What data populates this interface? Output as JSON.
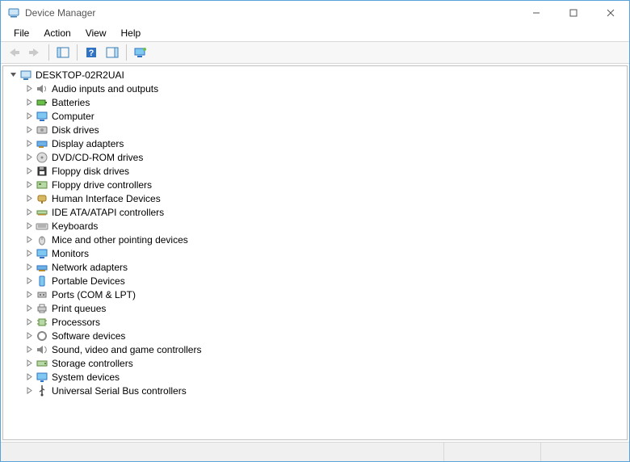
{
  "titlebar": {
    "title": "Device Manager"
  },
  "menubar": {
    "items": [
      "File",
      "Action",
      "View",
      "Help"
    ]
  },
  "toolbar": {
    "back": "Back",
    "forward": "Forward",
    "showhide": "Show/Hide Console Tree",
    "help": "Help",
    "actionpane": "Show/Hide Action Pane",
    "monitor": "Scan for hardware changes"
  },
  "tree": {
    "root": "DESKTOP-02R2UAI",
    "categories": [
      {
        "label": "Audio inputs and outputs",
        "icon": "speaker-icon"
      },
      {
        "label": "Batteries",
        "icon": "battery-icon"
      },
      {
        "label": "Computer",
        "icon": "monitor-icon"
      },
      {
        "label": "Disk drives",
        "icon": "disk-icon"
      },
      {
        "label": "Display adapters",
        "icon": "display-adapter-icon"
      },
      {
        "label": "DVD/CD-ROM drives",
        "icon": "optical-icon"
      },
      {
        "label": "Floppy disk drives",
        "icon": "floppy-icon"
      },
      {
        "label": "Floppy drive controllers",
        "icon": "floppy-controller-icon"
      },
      {
        "label": "Human Interface Devices",
        "icon": "hid-icon"
      },
      {
        "label": "IDE ATA/ATAPI controllers",
        "icon": "ide-icon"
      },
      {
        "label": "Keyboards",
        "icon": "keyboard-icon"
      },
      {
        "label": "Mice and other pointing devices",
        "icon": "mouse-icon"
      },
      {
        "label": "Monitors",
        "icon": "monitor-device-icon"
      },
      {
        "label": "Network adapters",
        "icon": "network-icon"
      },
      {
        "label": "Portable Devices",
        "icon": "portable-icon"
      },
      {
        "label": "Ports (COM & LPT)",
        "icon": "ports-icon"
      },
      {
        "label": "Print queues",
        "icon": "printer-icon"
      },
      {
        "label": "Processors",
        "icon": "cpu-icon"
      },
      {
        "label": "Software devices",
        "icon": "software-icon"
      },
      {
        "label": "Sound, video and game controllers",
        "icon": "sound-icon"
      },
      {
        "label": "Storage controllers",
        "icon": "storage-icon"
      },
      {
        "label": "System devices",
        "icon": "system-icon"
      },
      {
        "label": "Universal Serial Bus controllers",
        "icon": "usb-icon"
      }
    ]
  }
}
